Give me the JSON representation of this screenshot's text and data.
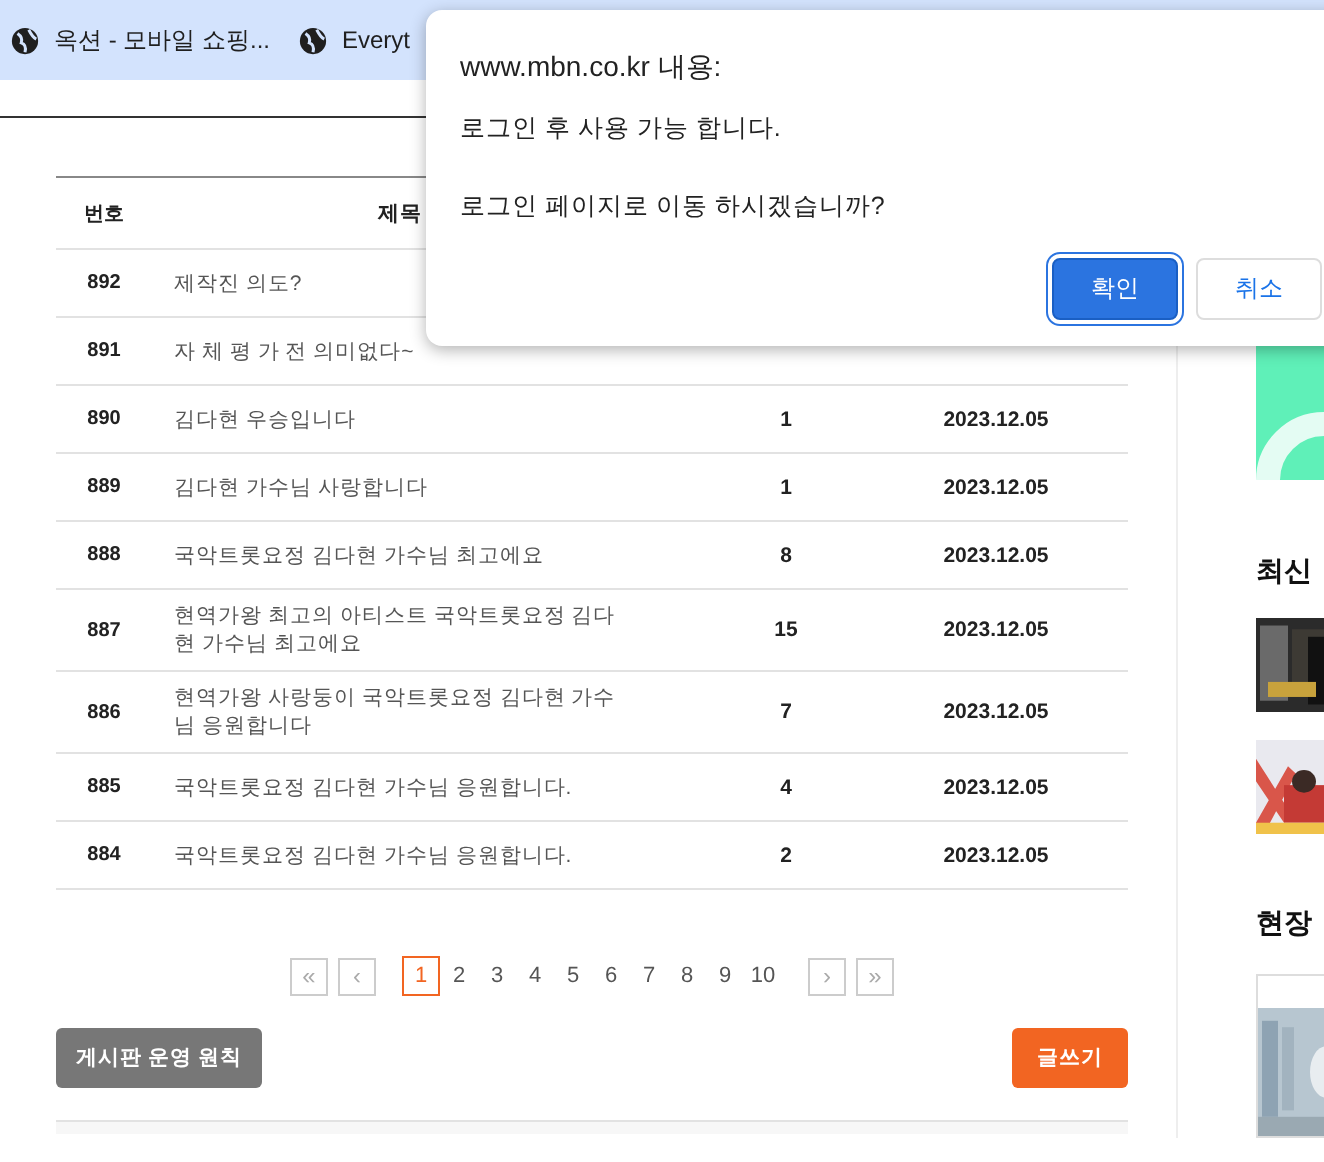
{
  "browser": {
    "bookmarks": [
      {
        "label": "옥션 - 모바일 쇼핑..."
      },
      {
        "label": "Everyt"
      }
    ]
  },
  "board": {
    "columns": [
      "번호",
      "제목"
    ],
    "rows": [
      {
        "no": "892",
        "title": "제작진 의도?"
      },
      {
        "no": "891",
        "title": "자 체 평 가 전 의미없다~"
      },
      {
        "no": "890",
        "title": "김다현 우승입니다",
        "count": "1",
        "date": "2023.12.05"
      },
      {
        "no": "889",
        "title": "김다현 가수님 사랑합니다",
        "count": "1",
        "date": "2023.12.05"
      },
      {
        "no": "888",
        "title": "국악트롯요정 김다현 가수님 최고에요",
        "count": "8",
        "date": "2023.12.05"
      },
      {
        "no": "887",
        "title": "현역가왕 최고의 아티스트 국악트롯요정 김다현 가수님 최고에요",
        "count": "15",
        "date": "2023.12.05"
      },
      {
        "no": "886",
        "title": "현역가왕 사랑둥이 국악트롯요정 김다현 가수님 응원합니다",
        "count": "7",
        "date": "2023.12.05"
      },
      {
        "no": "885",
        "title": "국악트롯요정 김다현 가수님 응원합니다.",
        "count": "4",
        "date": "2023.12.05"
      },
      {
        "no": "884",
        "title": "국악트롯요정 김다현 가수님 응원합니다.",
        "count": "2",
        "date": "2023.12.05"
      }
    ],
    "pagination": {
      "first": "«",
      "prev": "‹",
      "next": "›",
      "last": "»",
      "pages": [
        {
          "label": "1",
          "selected": true
        },
        {
          "label": "2",
          "selected": false
        },
        {
          "label": "3",
          "selected": false
        },
        {
          "label": "4",
          "selected": false
        },
        {
          "label": "5",
          "selected": false
        },
        {
          "label": "6",
          "selected": false
        },
        {
          "label": "7",
          "selected": false
        },
        {
          "label": "8",
          "selected": false
        },
        {
          "label": "9",
          "selected": false
        },
        {
          "label": "10",
          "selected": false
        }
      ]
    },
    "rules_button": "게시판 운영 원칙",
    "write_button": "글쓰기"
  },
  "sidebar": {
    "sections": [
      {
        "heading": "최신"
      },
      {
        "heading": "현장"
      }
    ]
  },
  "dialog": {
    "origin": "www.mbn.co.kr 내용:",
    "message": "로그인 후 사용 가능 합니다.",
    "question": "로그인 페이지로 이동 하시겠습니까?",
    "buttons": [
      {
        "label": "확인",
        "kind": "primary"
      },
      {
        "label": "취소",
        "kind": "secondary"
      }
    ]
  }
}
